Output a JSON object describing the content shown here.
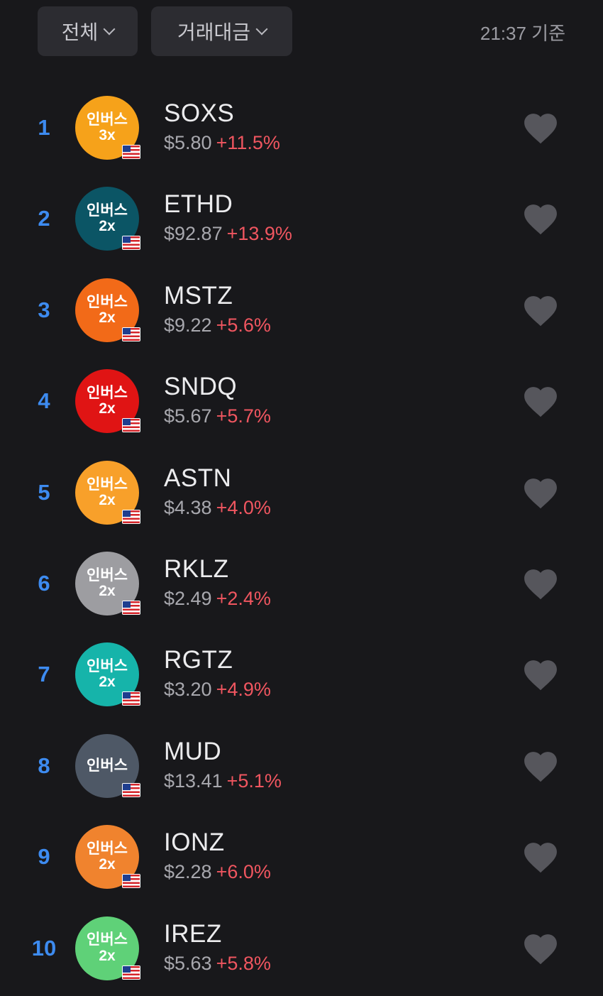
{
  "filters": {
    "market_label": "전체",
    "sort_label": "거래대금"
  },
  "timestamp": "21:37 기준",
  "colors": {
    "rank": "#3d8bf0",
    "change_up": "#f05660",
    "heart": "#56565c"
  },
  "stocks": [
    {
      "rank": "1",
      "logo_line1": "인버스",
      "logo_line2": "3x",
      "logo_color": "#f6a21a",
      "ticker": "SOXS",
      "price": "$5.80",
      "change": "+11.5%"
    },
    {
      "rank": "2",
      "logo_line1": "인버스",
      "logo_line2": "2x",
      "logo_color": "#0b5565",
      "ticker": "ETHD",
      "price": "$92.87",
      "change": "+13.9%"
    },
    {
      "rank": "3",
      "logo_line1": "인버스",
      "logo_line2": "2x",
      "logo_color": "#f26a18",
      "ticker": "MSTZ",
      "price": "$9.22",
      "change": "+5.6%"
    },
    {
      "rank": "4",
      "logo_line1": "인버스",
      "logo_line2": "2x",
      "logo_color": "#e01414",
      "ticker": "SNDQ",
      "price": "$5.67",
      "change": "+5.7%"
    },
    {
      "rank": "5",
      "logo_line1": "인버스",
      "logo_line2": "2x",
      "logo_color": "#f8a02a",
      "ticker": "ASTN",
      "price": "$4.38",
      "change": "+4.0%"
    },
    {
      "rank": "6",
      "logo_line1": "인버스",
      "logo_line2": "2x",
      "logo_color": "#9d9da1",
      "ticker": "RKLZ",
      "price": "$2.49",
      "change": "+2.4%"
    },
    {
      "rank": "7",
      "logo_line1": "인버스",
      "logo_line2": "2x",
      "logo_color": "#16b4aa",
      "ticker": "RGTZ",
      "price": "$3.20",
      "change": "+4.9%"
    },
    {
      "rank": "8",
      "logo_line1": "인버스",
      "logo_line2": "",
      "logo_color": "#4e5866",
      "ticker": "MUD",
      "price": "$13.41",
      "change": "+5.1%"
    },
    {
      "rank": "9",
      "logo_line1": "인버스",
      "logo_line2": "2x",
      "logo_color": "#f0832e",
      "ticker": "IONZ",
      "price": "$2.28",
      "change": "+6.0%"
    },
    {
      "rank": "10",
      "logo_line1": "인버스",
      "logo_line2": "2x",
      "logo_color": "#5fd178",
      "ticker": "IREZ",
      "price": "$5.63",
      "change": "+5.8%"
    }
  ]
}
